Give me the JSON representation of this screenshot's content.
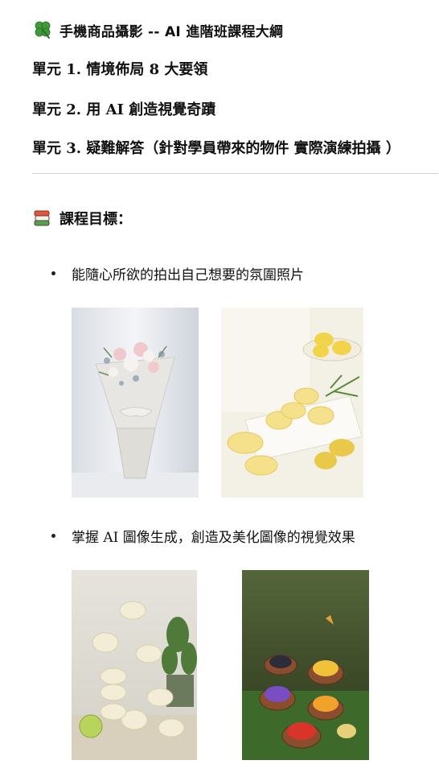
{
  "header": {
    "title": "手機商品攝影 -- AI 進階班課程大綱",
    "icon": "four-leaf-clover-icon"
  },
  "units": [
    {
      "label": "單元 1. 情境佈局 8 大要領"
    },
    {
      "label": "單元 2. 用 AI 創造視覺奇蹟"
    },
    {
      "label": "單元 3. 疑難解答（針對學員帶來的物件  實際演練拍攝 ）"
    }
  ],
  "goals": {
    "title": "課程目標：",
    "icon": "books-icon",
    "items": [
      {
        "text": "能隨心所欲的拍出自己想要的氛圍照片",
        "photos": [
          "flower-bouquet-photo",
          "lemon-cakes-photo"
        ]
      },
      {
        "text": "掌握 AI 圖像生成，創造及美化圖像的視覺效果",
        "photos": [
          "floating-macarons-photo",
          "fruit-jelly-forest-photo"
        ]
      }
    ]
  },
  "colors": {
    "clover": "#3f9a3a",
    "clover_dark": "#2c6e2a",
    "divider": "#cfcfcf"
  }
}
